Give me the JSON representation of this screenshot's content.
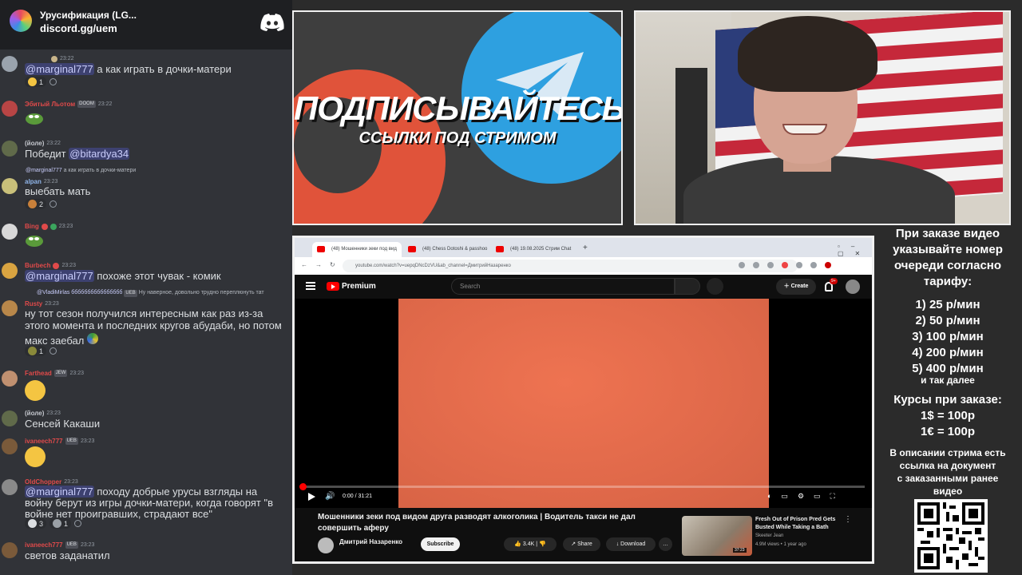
{
  "discord": {
    "server_name": "Урусификация (LG...",
    "invite": "discord.gg/uem",
    "messages": [
      {
        "author": "",
        "time": "23:22",
        "text_mention": "@marginal777",
        "text": " а как играть в дочки-матери",
        "reactions": [
          {
            "count": "1"
          }
        ]
      },
      {
        "author": "Эбитый Льотом",
        "badge": "DOOM",
        "time": "23:22"
      },
      {
        "author": "(йоле)",
        "time": "23:22",
        "text": "Победит ",
        "text_mention_after": "@bitardya34"
      },
      {
        "author": "alpan",
        "time": "23:23",
        "reply_mention": "@marginal777",
        "reply_text": " а как играть в дочки-матери",
        "text": "выебать мать",
        "reactions": [
          {
            "count": "2"
          }
        ]
      },
      {
        "author": "Bing",
        "time": "23:23"
      },
      {
        "author": "Burbech",
        "time": "23:23",
        "text_mention": "@marginal777",
        "text": " похоже этот чувак - комик"
      },
      {
        "author": "Rusty",
        "time": "23:23",
        "reply_author": "@VladiMirlas бббббббббббббббб",
        "reply_badge": "UEB",
        "reply_text": "Ну наверное, довольно трудно переплюнуть тат",
        "lines": [
          "ну тот сезон получился интересным как раз из-за",
          "этого момента и последних кругов абудаби, но потом",
          "макс заебал"
        ],
        "reactions": [
          {
            "count": "1"
          }
        ]
      },
      {
        "author": "Farthead",
        "badge": "JEW",
        "time": "23:23"
      },
      {
        "author": "(йоле)",
        "time": "23:23",
        "text": "Сенсей Какаши"
      },
      {
        "author": "ivaneech777",
        "badge": "UEB",
        "time": "23:23"
      },
      {
        "author": "OldChopper",
        "time": "23:23",
        "text_mention": "@marginal777",
        "lines": [
          " походу добрые  урусы взгляды на",
          "войну берут из игры дочки-матери, когда говорят \"в",
          "войне нет проигравших, страдают все\""
        ],
        "reactions": [
          {
            "count": "3"
          },
          {
            "count": "1"
          }
        ]
      },
      {
        "author": "ivaneech777",
        "badge": "UEB",
        "time": "23:23",
        "text": "светов заданатил"
      }
    ]
  },
  "promo": {
    "title": "ПОДПИСЫВАЙТЕСЬ",
    "subtitle": "ССЫЛКИ ПОД СТРИМОМ"
  },
  "browser": {
    "tabs": [
      {
        "label": "(48) Мошенники зеки под вид"
      },
      {
        "label": "(48) Chess Dotoshi & passhoo"
      },
      {
        "label": "(48) 19.08.2025 Стрим Chat"
      }
    ],
    "new_tab": "+",
    "url": "youtube.com/watch?v=uepqDNcDzVU&ab_channel=ДмитрийНазаренко",
    "youtube": {
      "logo_text": "Premium",
      "search_placeholder": "Search",
      "create_label": "Create",
      "notifications": "9+",
      "time": "0:00 / 31:21",
      "video_title": "Мошенники зеки под видом друга разводят алкоголика | Водитель такси не дал совершить аферу",
      "channel": "Дмитрий Назаренко",
      "subscribe": "Subscribe",
      "likes": "3.4K",
      "share": "Share",
      "download": "Download",
      "more": "…",
      "rec": {
        "title": "Fresh Out of Prison Pred Gets Busted While Taking a Bath",
        "channel": "Skeeter Jean",
        "stats": "4.9M views • 1 year ago",
        "duration": "37:23"
      }
    }
  },
  "info": {
    "order_lines": [
      "При заказе видео",
      "указывайте номер",
      "очереди согласно",
      "тарифу:"
    ],
    "prices": [
      "1) 25 р/мин",
      "2) 50 р/мин",
      "3) 100 р/мин",
      "4) 200 р/мин",
      "5) 400 р/мин"
    ],
    "etc": "и так далее",
    "rates": [
      "Курсы при заказе:",
      "1$ = 100р",
      "1€ = 100р"
    ],
    "desc": [
      "В описании стрима есть",
      "ссылка на документ",
      "с заказанными ранее",
      "видео"
    ]
  },
  "colors": {
    "discord_bg": "#313338",
    "mention": "#c9cdfb",
    "promo_red": "#e0533a",
    "promo_blue": "#2ea0e0",
    "yt_red": "#ff0000"
  }
}
